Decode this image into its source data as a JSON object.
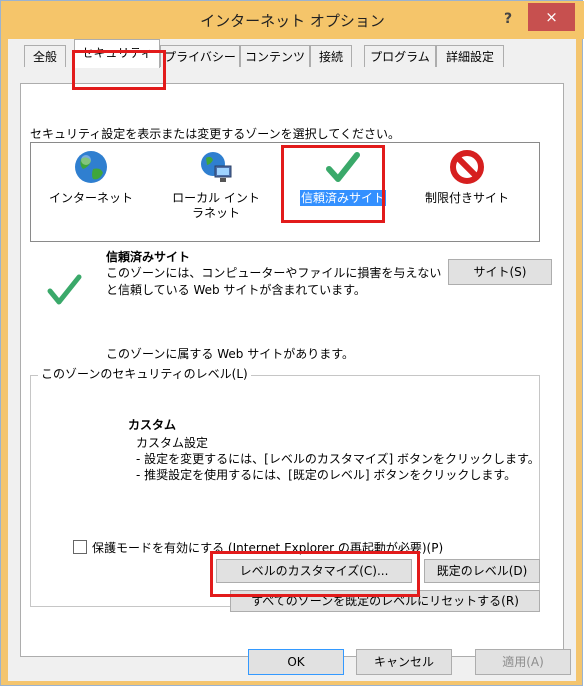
{
  "window": {
    "title": "インターネット オプション",
    "help": "?",
    "close": "×"
  },
  "tabs": [
    "全般",
    "セキュリティ",
    "プライバシー",
    "コンテンツ",
    "接続",
    "プログラム",
    "詳細設定"
  ],
  "security": {
    "zone_prompt": "セキュリティ設定を表示または変更するゾーンを選択してください。",
    "zones": [
      {
        "label": "インターネット",
        "icon": "globe-icon"
      },
      {
        "label": "ローカル イントラネット",
        "icon": "intranet-icon"
      },
      {
        "label": "信頼済みサイト",
        "icon": "checkmark-icon",
        "selected": true
      },
      {
        "label": "制限付きサイト",
        "icon": "restricted-icon"
      }
    ],
    "zone_name": "信頼済みサイト",
    "zone_desc1": "このゾーンには、コンピューターやファイルに損害を与えない",
    "zone_desc2": "と信頼している Web サイトが含まれています。",
    "sites_button": "サイト(S)",
    "sites_note": "このゾーンに属する Web サイトがあります。",
    "group_title": "このゾーンのセキュリティのレベル(L)",
    "level_name": "カスタム",
    "level_line1": "カスタム設定",
    "level_line2": "- 設定を変更するには、[レベルのカスタマイズ] ボタンをクリックします。",
    "level_line3": "- 推奨設定を使用するには、[既定のレベル] ボタンをクリックします。",
    "protected_mode": "保護モードを有効にする (Internet Explorer の再起動が必要)(P)",
    "protected_checked": false,
    "custom_level_button": "レベルのカスタマイズ(C)...",
    "default_level_button": "既定のレベル(D)",
    "reset_all_button": "すべてのゾーンを既定のレベルにリセットする(R)"
  },
  "footer": {
    "ok": "OK",
    "cancel": "キャンセル",
    "apply": "適用(A)"
  },
  "colors": {
    "title_bar": "#f5c56a",
    "close": "#c7504f",
    "highlight": "#e21b1b",
    "selection": "#3390ff"
  }
}
